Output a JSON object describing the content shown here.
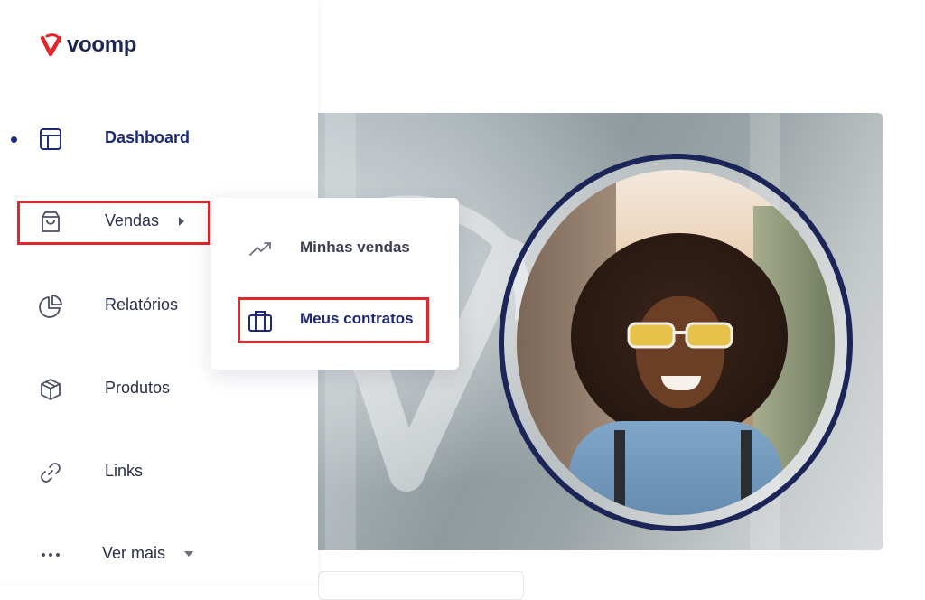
{
  "brand": {
    "name": "voomp"
  },
  "sidebar": {
    "items": [
      {
        "label": "Dashboard",
        "icon": "layout-icon",
        "active": true
      },
      {
        "label": "Vendas",
        "icon": "shopping-bag-icon",
        "has_submenu": true
      },
      {
        "label": "Relatórios",
        "icon": "pie-chart-icon"
      },
      {
        "label": "Produtos",
        "icon": "package-icon"
      },
      {
        "label": "Links",
        "icon": "link-icon"
      },
      {
        "label": "Ver mais",
        "icon": "more-dots-icon",
        "has_dropdown": true
      }
    ]
  },
  "submenu": {
    "items": [
      {
        "label": "Minhas vendas",
        "icon": "trending-up-icon"
      },
      {
        "label": "Meus contratos",
        "icon": "briefcase-icon",
        "highlighted": true
      }
    ]
  },
  "colors": {
    "brand_navy": "#1e2a78",
    "brand_red": "#e1262c",
    "text_default": "#2a2f4a",
    "highlight_border": "#e1262c",
    "ring": "#1b2557"
  }
}
